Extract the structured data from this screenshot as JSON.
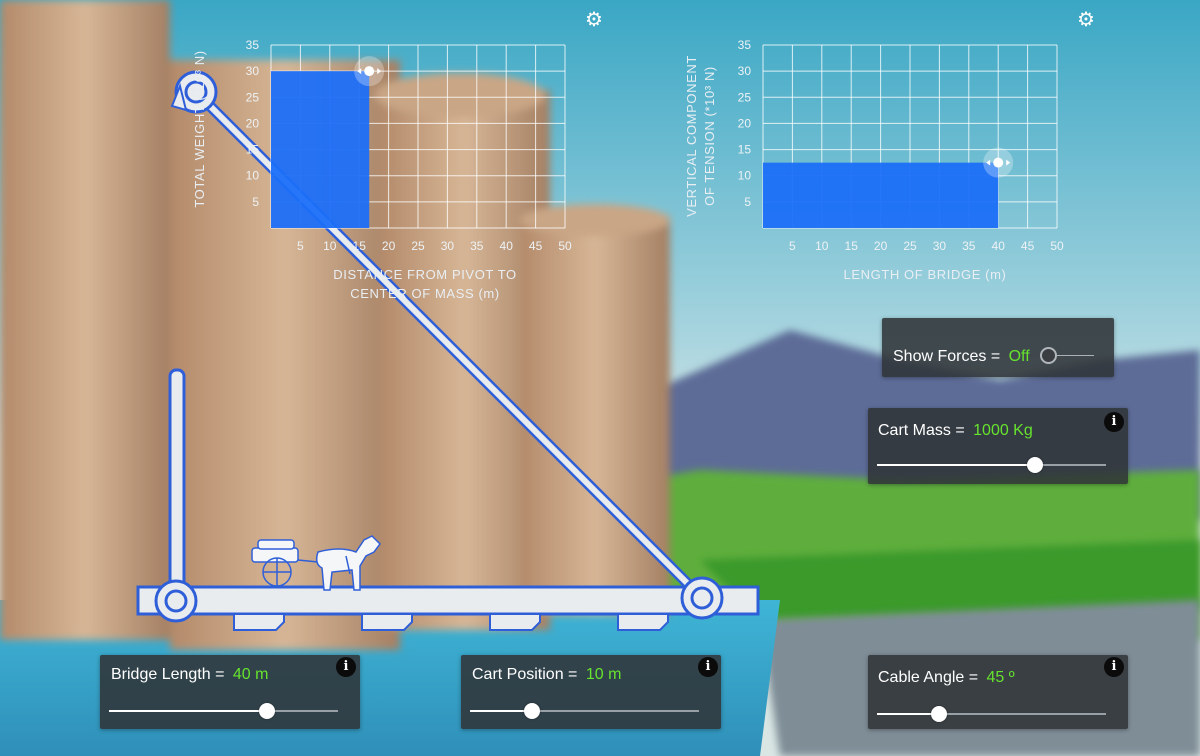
{
  "colors": {
    "accent_value": "#66e32e",
    "bar": "#1c6ff8",
    "grid": "#ffffff",
    "panel": "#303438"
  },
  "chart_data": [
    {
      "type": "bar",
      "title": "",
      "xlabel": "DISTANCE FROM PIVOT TO CENTER OF MASS (m)",
      "ylabel": "TOTAL WEIGHT (*10³ N)",
      "xlim": [
        0,
        50
      ],
      "ylim": [
        0,
        35
      ],
      "xticks": [
        5,
        10,
        15,
        20,
        25,
        30,
        35,
        40,
        45,
        50
      ],
      "yticks": [
        5,
        10,
        15,
        20,
        25,
        30,
        35
      ],
      "x_labels": [
        "5",
        "10",
        "15",
        "20",
        "25",
        "30",
        "35",
        "40",
        "45",
        "50"
      ],
      "y_labels": [
        "5",
        "10",
        "15",
        "20",
        "25",
        "30",
        "35"
      ],
      "grid": true,
      "bar": {
        "x_start": 0,
        "x_end": 16.7,
        "value": 30
      },
      "handle": {
        "x": 16.7,
        "y": 30
      }
    },
    {
      "type": "bar",
      "title": "",
      "xlabel": "LENGTH OF BRIDGE (m)",
      "ylabel": "VERTICAL COMPONENT OF TENSION (*10³ N)",
      "xlim": [
        0,
        50
      ],
      "ylim": [
        0,
        35
      ],
      "xticks": [
        5,
        10,
        15,
        20,
        25,
        30,
        35,
        40,
        45,
        50
      ],
      "yticks": [
        5,
        10,
        15,
        20,
        25,
        30,
        35
      ],
      "x_labels": [
        "5",
        "10",
        "15",
        "20",
        "25",
        "30",
        "35",
        "40",
        "45",
        "50"
      ],
      "y_labels": [
        "5",
        "10",
        "15",
        "20",
        "25",
        "30",
        "35"
      ],
      "grid": true,
      "bar": {
        "x_start": 0,
        "x_end": 40,
        "value": 12.5
      },
      "handle": {
        "x": 40,
        "y": 12.5
      }
    }
  ],
  "charts": {
    "left": {
      "xlabel_line1": "DISTANCE FROM PIVOT TO",
      "xlabel_line2": "CENTER OF MASS (m)",
      "ylabel": "TOTAL WEIGHT (*10³ N)"
    },
    "right": {
      "xlabel_line1": "LENGTH OF BRIDGE (m)",
      "ylabel_line1": "VERTICAL COMPONENT",
      "ylabel_line2": "OF TENSION (*10³ N)"
    }
  },
  "controls": {
    "show_forces": {
      "label": "Show Forces =",
      "value": "Off",
      "state": false
    },
    "cart_mass": {
      "label": "Cart Mass =",
      "value": "1000 Kg",
      "fraction": 0.69
    },
    "bridge_length": {
      "label": "Bridge Length =",
      "value": "40 m",
      "fraction": 0.69
    },
    "cart_position": {
      "label": "Cart Position =",
      "value": "10 m",
      "fraction": 0.27
    },
    "cable_angle": {
      "label": "Cable Angle =",
      "value": "45 º",
      "fraction": 0.27
    },
    "info_glyph": "i",
    "gear_glyph": "⚙"
  }
}
